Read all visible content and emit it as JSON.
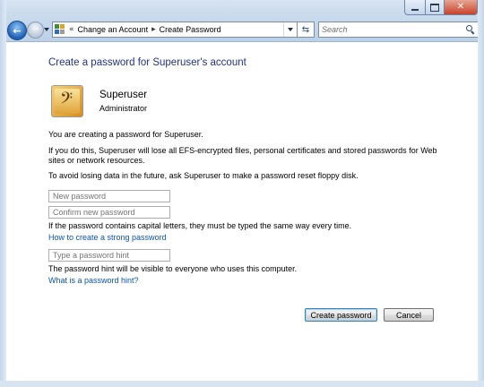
{
  "breadcrumb": {
    "items": [
      "Change an Account",
      "Create Password"
    ]
  },
  "search": {
    "placeholder": "Search"
  },
  "content": {
    "heading": "Create a password for Superuser's account",
    "user": {
      "name": "Superuser",
      "role": "Administrator"
    },
    "text_creating": "You are creating a password for Superuser.",
    "text_warning": "If you do this, Superuser will lose all EFS-encrypted files, personal certificates and stored passwords for Web sites or network resources.",
    "text_avoid": "To avoid losing data in the future, ask Superuser to make a password reset floppy disk.",
    "fields": {
      "new_password": {
        "placeholder": "New password",
        "value": ""
      },
      "confirm_password": {
        "placeholder": "Confirm new password",
        "value": ""
      },
      "hint": {
        "placeholder": "Type a password hint",
        "value": ""
      }
    },
    "text_capitals": "If the password contains capital letters, they must be typed the same way every time.",
    "link_strong": "How to create a strong password",
    "text_hint_visible": "The password hint will be visible to everyone who uses this computer.",
    "link_hint": "What is a password hint?"
  },
  "buttons": {
    "create": "Create password",
    "cancel": "Cancel"
  },
  "icons": {
    "back": "back-arrow-icon",
    "forward": "forward-arrow-icon",
    "refresh": "refresh-icon",
    "search": "search-icon",
    "control_panel": "control-panel-icon",
    "user_picture": "bass-clef-user-picture"
  },
  "colors": {
    "heading": "#1e3287",
    "link": "#0a53b4",
    "frame": "#c6d8ec"
  }
}
